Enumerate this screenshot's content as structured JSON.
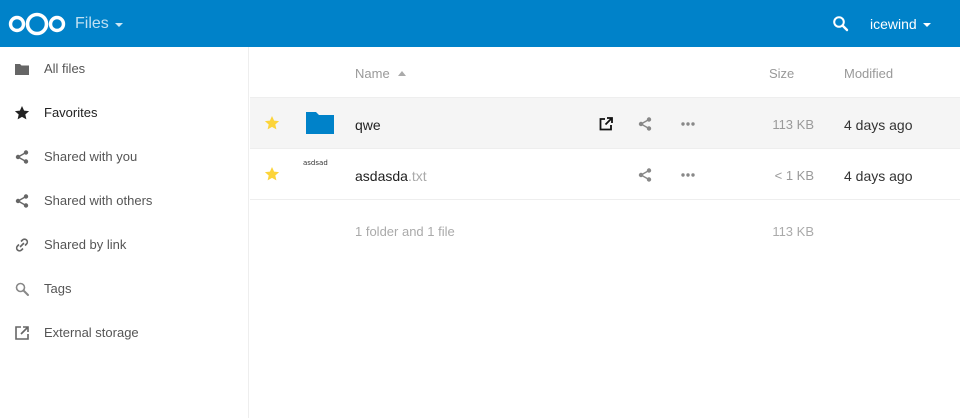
{
  "header": {
    "app_name": "Files",
    "user_name": "icewind",
    "brand_color": "#0082c9",
    "icons": {
      "logo": "nextcloud-logo",
      "search": "search-icon"
    }
  },
  "sidebar": {
    "items": [
      {
        "label": "All files",
        "icon": "folder-icon"
      },
      {
        "label": "Favorites",
        "icon": "star-icon",
        "active": true
      },
      {
        "label": "Shared with you",
        "icon": "share-icon"
      },
      {
        "label": "Shared with others",
        "icon": "share-icon"
      },
      {
        "label": "Shared by link",
        "icon": "link-icon"
      },
      {
        "label": "Tags",
        "icon": "tag-search-icon"
      },
      {
        "label": "External storage",
        "icon": "external-icon"
      }
    ]
  },
  "table": {
    "columns": {
      "name": "Name",
      "size": "Size",
      "modified": "Modified"
    },
    "rows": [
      {
        "name": "qwe",
        "ext": "",
        "size": "113 KB",
        "modified": "4 days ago",
        "type": "folder",
        "favorite": true
      },
      {
        "name": "asdasda",
        "ext": ".txt",
        "size": "< 1 KB",
        "modified": "4 days ago",
        "type": "file",
        "thumb_text": "asdsad",
        "favorite": true
      }
    ],
    "summary": {
      "text": "1 folder and 1 file",
      "size": "113 KB"
    }
  },
  "colors": {
    "star": "#fcd43a",
    "folder": "#0082c9"
  }
}
